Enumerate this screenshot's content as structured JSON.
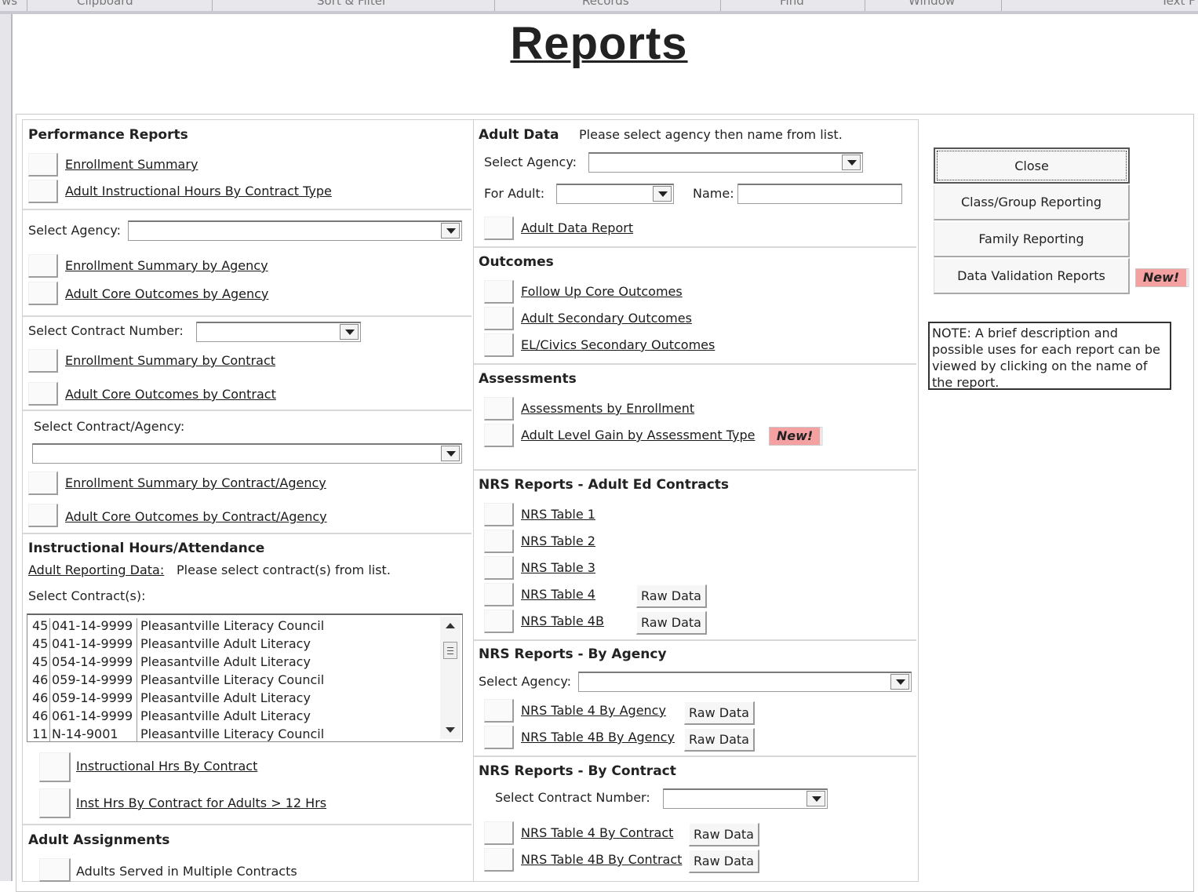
{
  "ribbon": {
    "groups": [
      "ws",
      "Clipboard",
      "Sort & Filter",
      "Records",
      "Find",
      "Window",
      "Text F"
    ]
  },
  "page_title": "Reports",
  "performance": {
    "heading": "Performance Reports",
    "enrollment_summary": "Enrollment Summary",
    "adult_instr_hours": "Adult Instructional Hours By Contract Type",
    "select_agency_label": "Select Agency:",
    "enroll_by_agency": "Enrollment Summary by Agency",
    "core_by_agency": "Adult Core Outcomes by Agency",
    "select_contract_label": "Select Contract Number:",
    "enroll_by_contract": "Enrollment Summary by Contract",
    "core_by_contract": "Adult Core Outcomes by Contract",
    "select_contract_agency_label": "Select Contract/Agency:",
    "enroll_by_contract_agency": "Enrollment Summary by Contract/Agency",
    "core_by_contract_agency": "Adult Core Outcomes by Contract/Agency"
  },
  "instructional": {
    "heading": "Instructional Hours/Attendance",
    "adult_reporting_link": "Adult Reporting Data:",
    "instruction_text": "Please select contract(s) from list.",
    "select_contracts_label": "Select Contract(s):",
    "contracts": [
      {
        "id": "45",
        "number": "041-14-9999",
        "name": "Pleasantville Literacy Council"
      },
      {
        "id": "45",
        "number": "041-14-9999",
        "name": "Pleasantville Adult Literacy"
      },
      {
        "id": "45",
        "number": "054-14-9999",
        "name": "Pleasantville Adult Literacy"
      },
      {
        "id": "46",
        "number": "059-14-9999",
        "name": "Pleasantville Literacy Council"
      },
      {
        "id": "46",
        "number": "059-14-9999",
        "name": "Pleasantville Adult Literacy"
      },
      {
        "id": "46",
        "number": "061-14-9999",
        "name": "Pleasantville Adult Literacy"
      },
      {
        "id": "11",
        "number": "N-14-9001",
        "name": "Pleasantville Literacy Council"
      }
    ],
    "instr_by_contract": "Instructional Hrs By Contract",
    "inst_over_12": "Inst Hrs By Contract for Adults > 12 Hrs"
  },
  "assignments": {
    "heading": "Adult Assignments",
    "multiple_contracts": "Adults Served in Multiple Contracts"
  },
  "adult_data": {
    "heading": "Adult Data",
    "instruction": "Please select agency then name from list.",
    "select_agency_label": "Select Agency:",
    "for_adult_label": "For Adult:",
    "name_label": "Name:",
    "report_link": "Adult Data Report"
  },
  "outcomes": {
    "heading": "Outcomes",
    "follow_up": "Follow Up Core Outcomes",
    "secondary": "Adult Secondary Outcomes",
    "el_civics": "EL/Civics Secondary Outcomes"
  },
  "assessments": {
    "heading": "Assessments",
    "by_enrollment": "Assessments by Enrollment",
    "level_gain": "Adult Level Gain by Assessment Type",
    "new_badge": "New!"
  },
  "nrs_adult_ed": {
    "heading": "NRS Reports - Adult Ed Contracts",
    "table1": "NRS Table 1",
    "table2": "NRS Table 2",
    "table3": "NRS Table 3",
    "table4": "NRS Table 4",
    "table4b": "NRS Table 4B",
    "raw_data": "Raw Data"
  },
  "nrs_agency": {
    "heading": "NRS Reports - By Agency",
    "select_agency_label": "Select Agency:",
    "table4": "NRS Table 4 By Agency",
    "table4b": "NRS Table 4B By Agency",
    "raw_data": "Raw Data"
  },
  "nrs_contract": {
    "heading": "NRS Reports - By Contract",
    "select_contract_label": "Select Contract Number:",
    "table4": "NRS Table 4 By Contract",
    "table4b": "NRS Table 4B By Contract",
    "raw_data": "Raw Data"
  },
  "side": {
    "close": "Close",
    "class_group": "Class/Group Reporting",
    "family": "Family Reporting",
    "data_validation": "Data Validation Reports",
    "new_badge": "New!",
    "note": "NOTE: A brief description and possible uses for each report can be viewed by clicking on the name of the report."
  },
  "colors": {
    "new_badge": "#f6a1a1",
    "ribbon": "#e8e8ec"
  }
}
